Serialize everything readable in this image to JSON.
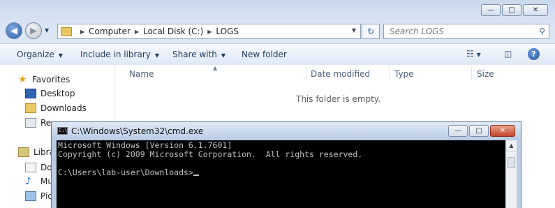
{
  "explorer": {
    "address": {
      "crumbs": [
        "Computer",
        "Local Disk (C:)",
        "LOGS"
      ]
    },
    "search": {
      "placeholder": "Search LOGS"
    },
    "commands": {
      "organize": "Organize",
      "include_in_library": "Include in library",
      "share_with": "Share with",
      "new_folder": "New folder"
    },
    "nav": {
      "favorites": "Favorites",
      "desktop": "Desktop",
      "downloads": "Downloads",
      "recent": "Re",
      "libraries": "Libra",
      "lib_documents": "Do",
      "lib_music": "Mu",
      "lib_pictures": "Pic"
    },
    "columns": [
      "Name",
      "Date modified",
      "Type",
      "Size"
    ],
    "empty_message": "This folder is empty."
  },
  "cmd": {
    "title": "C:\\Windows\\System32\\cmd.exe",
    "lines": [
      "Microsoft Windows [Version 6.1.7601]",
      "Copyright (c) 2009 Microsoft Corporation.  All rights reserved.",
      "",
      "C:\\Users\\lab-user\\Downloads>"
    ]
  },
  "colors": {
    "frame": "#dbe6f4",
    "console_bg": "#000000",
    "console_fg": "#c0c0c0",
    "accent": "#1e395b"
  }
}
